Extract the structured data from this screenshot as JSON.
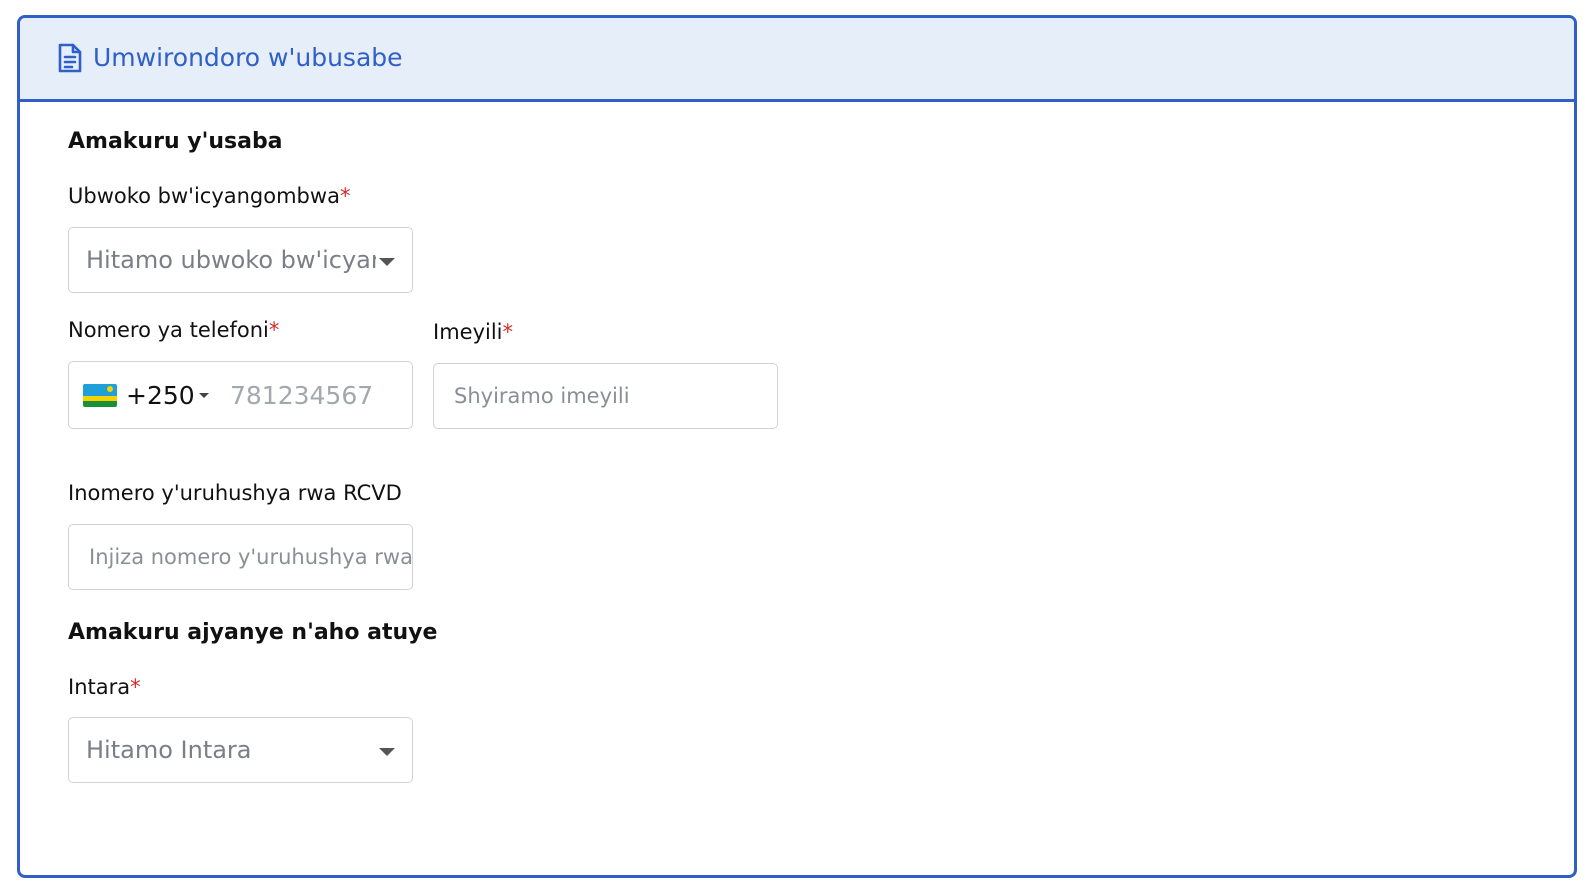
{
  "header": {
    "title": "Umwirondoro w'ubusabe",
    "icon": "document-icon",
    "accent_color": "#2f5fc7",
    "background_color": "#e6eefa"
  },
  "sections": {
    "applicant": {
      "title": "Amakuru y'usaba"
    },
    "location": {
      "title": "Amakuru ajyanye n'aho atuye"
    }
  },
  "fields": {
    "id_type": {
      "label": "Ubwoko bw'icyangombwa",
      "required_mark": "*",
      "placeholder": "Hitamo ubwoko bw'icyangombwa"
    },
    "phone": {
      "label": "Nomero ya telefoni",
      "required_mark": "*",
      "country_flag": "rwanda-flag-icon",
      "dial_code": "+250",
      "placeholder": "781234567"
    },
    "email": {
      "label": "Imeyili",
      "required_mark": "*",
      "placeholder": "Shyiramo imeyili"
    },
    "rcvd": {
      "label": "Inomero y'uruhushya rwa RCVD",
      "placeholder": "Injiza nomero y'uruhushya rwa RCVD"
    },
    "province": {
      "label": "Intara",
      "required_mark": "*",
      "placeholder": "Hitamo Intara"
    }
  },
  "colors": {
    "required": "#d42b2b",
    "border": "#cfd3d9",
    "placeholder": "#7a7f87"
  }
}
